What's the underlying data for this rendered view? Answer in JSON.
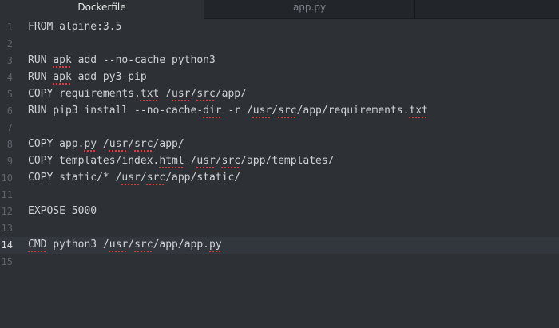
{
  "tabs": [
    {
      "label": "Dockerfile",
      "active": true
    },
    {
      "label": "app.py",
      "active": false
    }
  ],
  "current_line": 14,
  "lines": [
    {
      "num": "1",
      "segments": [
        {
          "t": "FROM alpine:3.5"
        }
      ]
    },
    {
      "num": "2",
      "segments": []
    },
    {
      "num": "3",
      "segments": [
        {
          "t": "RUN "
        },
        {
          "t": "apk",
          "s": true
        },
        {
          "t": " add --no-cache python3"
        }
      ]
    },
    {
      "num": "4",
      "segments": [
        {
          "t": "RUN "
        },
        {
          "t": "apk",
          "s": true
        },
        {
          "t": " add py3-pip"
        }
      ]
    },
    {
      "num": "5",
      "segments": [
        {
          "t": "COPY requirements."
        },
        {
          "t": "txt",
          "s": true
        },
        {
          "t": " /"
        },
        {
          "t": "usr",
          "s": true
        },
        {
          "t": "/"
        },
        {
          "t": "src",
          "s": true
        },
        {
          "t": "/app/"
        }
      ]
    },
    {
      "num": "6",
      "segments": [
        {
          "t": "RUN pip3 install --no-cache-"
        },
        {
          "t": "dir",
          "s": true
        },
        {
          "t": " -r /"
        },
        {
          "t": "usr",
          "s": true
        },
        {
          "t": "/"
        },
        {
          "t": "src",
          "s": true
        },
        {
          "t": "/app/requirements."
        },
        {
          "t": "txt",
          "s": true
        }
      ]
    },
    {
      "num": "7",
      "segments": []
    },
    {
      "num": "8",
      "segments": [
        {
          "t": "COPY app."
        },
        {
          "t": "py",
          "s": true
        },
        {
          "t": " /"
        },
        {
          "t": "usr",
          "s": true
        },
        {
          "t": "/"
        },
        {
          "t": "src",
          "s": true
        },
        {
          "t": "/app/"
        }
      ]
    },
    {
      "num": "9",
      "segments": [
        {
          "t": "COPY templates/index."
        },
        {
          "t": "html",
          "s": true
        },
        {
          "t": " /"
        },
        {
          "t": "usr",
          "s": true
        },
        {
          "t": "/"
        },
        {
          "t": "src",
          "s": true
        },
        {
          "t": "/app/templates/"
        }
      ]
    },
    {
      "num": "10",
      "segments": [
        {
          "t": "COPY static/* /"
        },
        {
          "t": "usr",
          "s": true
        },
        {
          "t": "/"
        },
        {
          "t": "src",
          "s": true
        },
        {
          "t": "/app/static/"
        }
      ]
    },
    {
      "num": "11",
      "segments": []
    },
    {
      "num": "12",
      "segments": [
        {
          "t": "EXPOSE 5000"
        }
      ]
    },
    {
      "num": "13",
      "segments": []
    },
    {
      "num": "14",
      "segments": [
        {
          "t": "CMD",
          "s": true
        },
        {
          "t": " python3 /"
        },
        {
          "t": "usr",
          "s": true
        },
        {
          "t": "/"
        },
        {
          "t": "src",
          "s": true
        },
        {
          "t": "/app/app."
        },
        {
          "t": "py",
          "s": true
        }
      ]
    },
    {
      "num": "15",
      "segments": []
    }
  ]
}
